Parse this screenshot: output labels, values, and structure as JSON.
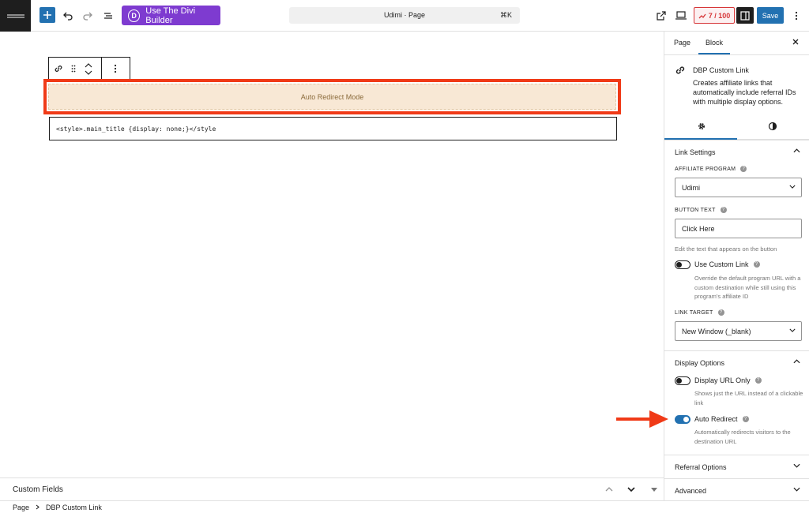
{
  "toolbar": {
    "divi_label": "Use The Divi Builder",
    "divi_logo_letter": "D",
    "doc_title": "Udimi · Page",
    "shortcut": "⌘K",
    "counter": "7 / 100",
    "save_label": "Save"
  },
  "canvas": {
    "redirect_block_text": "Auto Redirect Mode",
    "code_text": "<style>.main_title {display: none;}</style"
  },
  "custom_fields": {
    "label": "Custom Fields"
  },
  "breadcrumb": {
    "root": "Page",
    "current": "DBP Custom Link"
  },
  "sidebar": {
    "tabs": [
      {
        "label": "Page"
      },
      {
        "label": "Block"
      }
    ],
    "block": {
      "name": "DBP Custom Link",
      "description": "Creates affiliate links that automatically include referral IDs with multiple display options."
    },
    "link_settings": {
      "title": "Link Settings",
      "affiliate_program_label": "AFFILIATE PROGRAM",
      "affiliate_program_value": "Udimi",
      "button_text_label": "BUTTON TEXT",
      "button_text_value": "Click Here",
      "button_text_help": "Edit the text that appears on the button",
      "use_custom_link_label": "Use Custom Link",
      "use_custom_link_help": "Override the default program URL with a custom destination while still using this program's affiliate ID",
      "link_target_label": "LINK TARGET",
      "link_target_value": "New Window (_blank)"
    },
    "display_options": {
      "title": "Display Options",
      "display_url_only_label": "Display URL Only",
      "display_url_only_help": "Shows just the URL instead of a clickable link",
      "auto_redirect_label": "Auto Redirect",
      "auto_redirect_help": "Automatically redirects visitors to the destination URL",
      "auto_redirect_on": true
    },
    "referral_options": {
      "title": "Referral Options"
    },
    "advanced": {
      "title": "Advanced"
    }
  },
  "colors": {
    "accent": "#2271b1",
    "divi": "#7e3bd0",
    "highlight": "#f03a17",
    "block_bg": "#f8e8d5"
  }
}
